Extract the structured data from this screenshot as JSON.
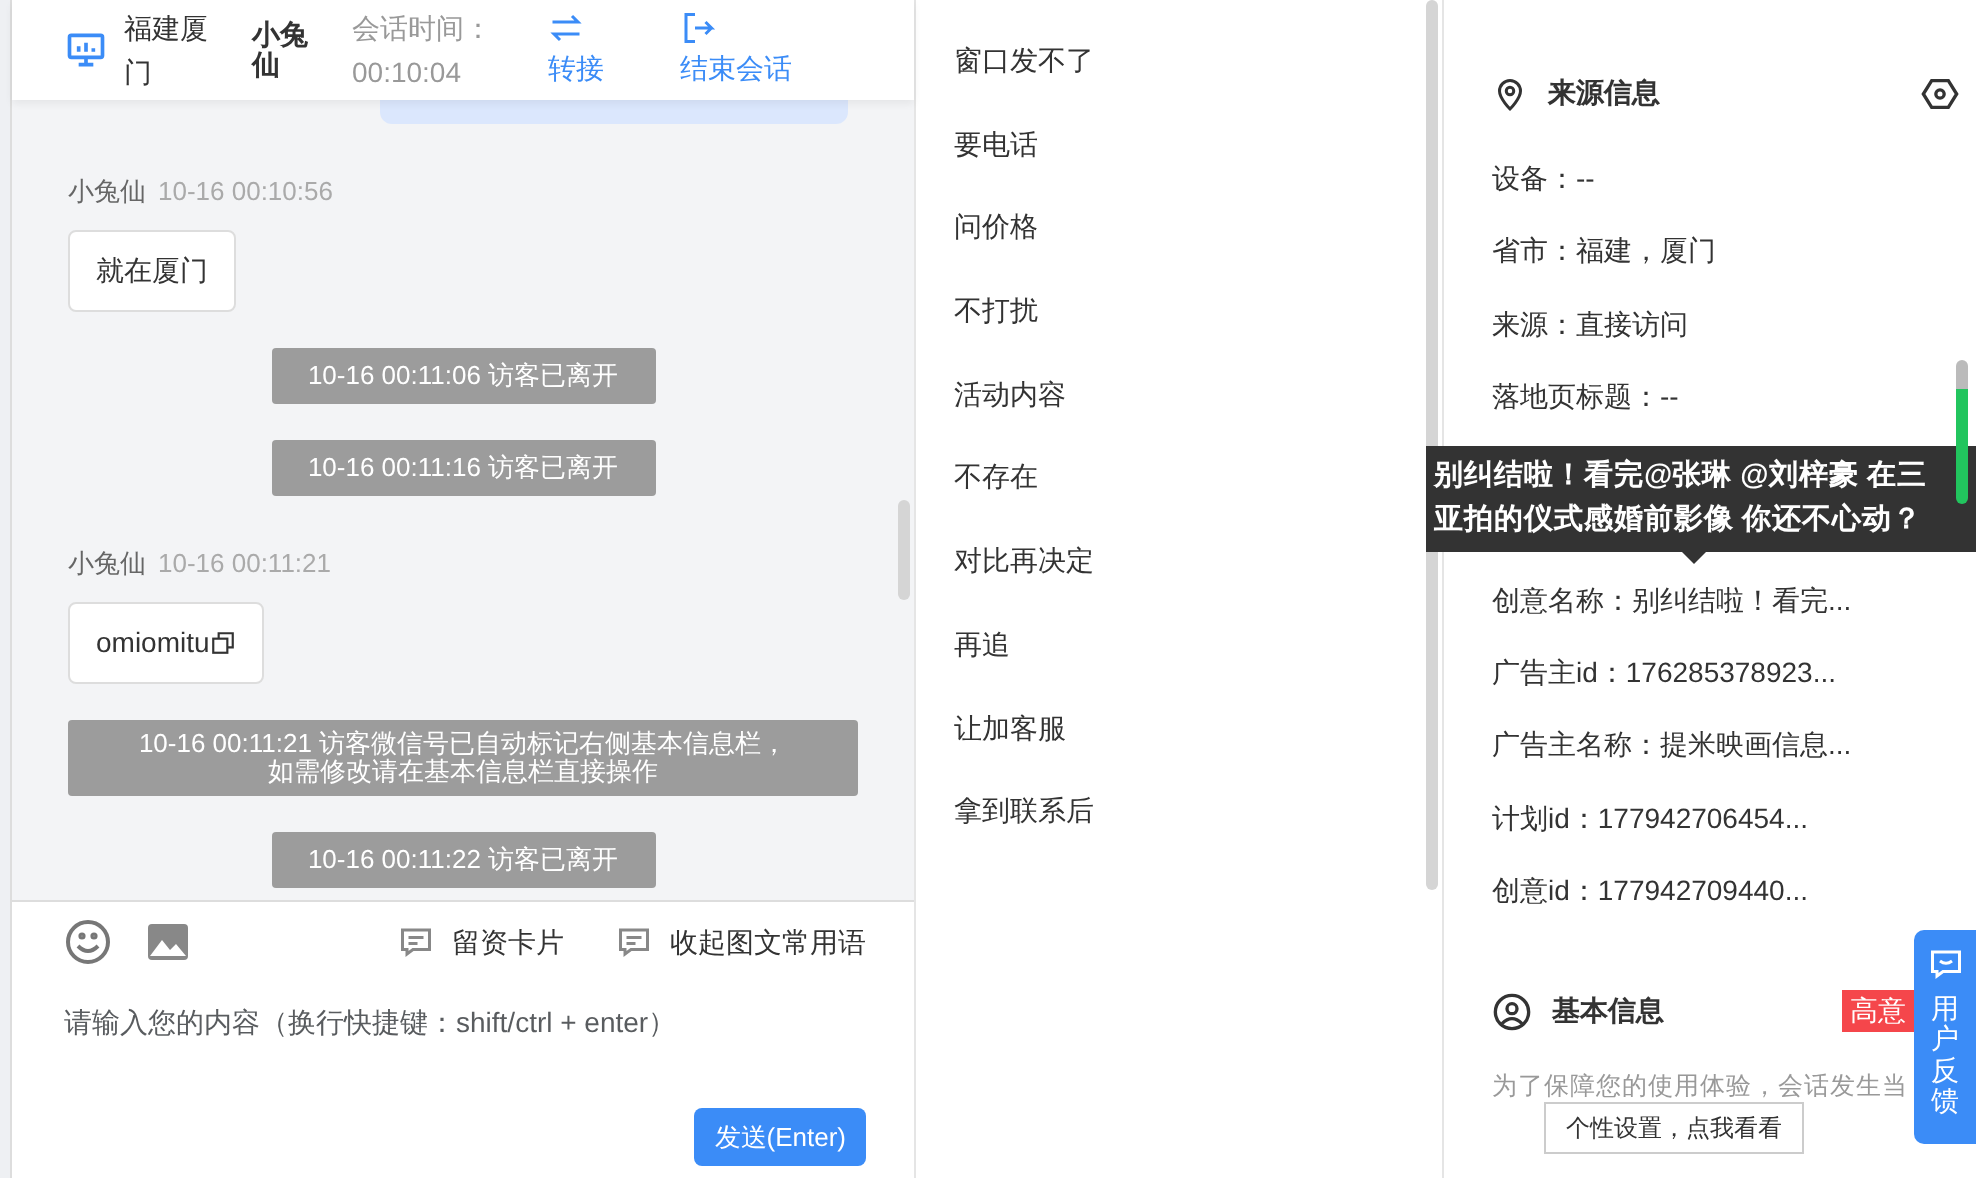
{
  "header": {
    "location": "福建厦门",
    "visitor": "小兔仙",
    "session_time_label": "会话时间：",
    "session_time": "00:10:04",
    "actions": [
      {
        "kind": "transfer",
        "label": "转接"
      },
      {
        "kind": "end",
        "label": "结束会话"
      }
    ]
  },
  "messages": [
    {
      "kind": "agent_cut"
    },
    {
      "kind": "visitor",
      "sender": "小兔仙",
      "time": "10-16 00:10:56",
      "text": "就在厦门",
      "copyable": false
    },
    {
      "kind": "system",
      "text": "10-16 00:11:06 访客已离开"
    },
    {
      "kind": "system",
      "text": "10-16 00:11:16 访客已离开"
    },
    {
      "kind": "visitor",
      "sender": "小兔仙",
      "time": "10-16 00:11:21",
      "text": "omiomitu",
      "copyable": true
    },
    {
      "kind": "system_long",
      "lines": [
        "10-16 00:11:21 访客微信号已自动标记右侧基本信息栏，",
        "如需修改请在基本信息栏直接操作"
      ]
    },
    {
      "kind": "system",
      "text": "10-16 00:11:22 访客已离开"
    }
  ],
  "composer": {
    "links": [
      "留资卡片",
      "收起图文常用语"
    ],
    "placeholder": "请输入您的内容（换行快捷键：shift/ctrl + enter）",
    "send_label": "发送(Enter)"
  },
  "quick_replies": [
    "窗口发不了",
    "要电话",
    "问价格",
    "不打扰",
    "活动内容",
    "不存在",
    "对比再决定",
    "再追",
    "让加客服",
    "拿到联系后"
  ],
  "source_info": {
    "title": "来源信息",
    "rows_before": [
      "设备：--",
      "省市：福建，厦门",
      "来源：直接访问",
      "落地页标题：--"
    ],
    "tooltip": [
      "别纠结啦！看完@张琳 @刘梓豪 在三",
      "亚拍的仪式感婚前影像 你还不心动？"
    ],
    "rows_after": [
      "创意名称：别纠结啦！看完...",
      "广告主id：176285378923...",
      "广告主名称：提米映画信息...",
      "计划id：177942706454...",
      "创意id：177942709440..."
    ]
  },
  "basic_info": {
    "title": "基本信息",
    "tag": "高意",
    "notice": "为了保障您的使用体验，会话发生当",
    "popover": "个性设置，点我看看"
  },
  "feedback": {
    "label": "用户反馈"
  }
}
